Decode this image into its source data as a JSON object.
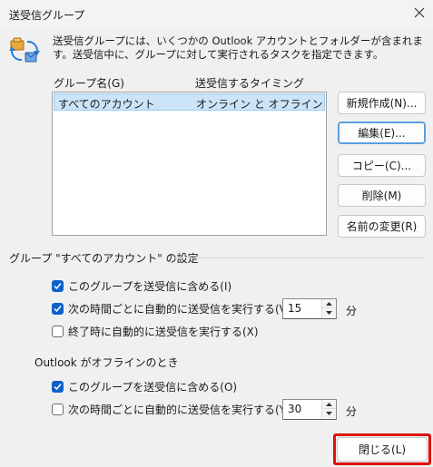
{
  "window": {
    "title": "送受信グループ",
    "close_icon": "close-icon"
  },
  "description": "送受信グループには、いくつかの Outlook アカウントとフォルダーが含まれます。送受信中に、グループに対して実行されるタスクを指定できます。",
  "list": {
    "col_name": "グループ名(G)",
    "col_timing": "送受信するタイミング",
    "rows": [
      {
        "name": "すべてのアカウント",
        "timing": "オンライン と オフライン"
      }
    ]
  },
  "buttons": {
    "new": "新規作成(N)...",
    "edit": "編集(E)...",
    "copy": "コピー(C)...",
    "delete": "削除(M)",
    "rename": "名前の変更(R)",
    "close": "閉じる(L)"
  },
  "settings": {
    "group_title": "グループ \"すべてのアカウント\" の設定",
    "online": {
      "include_label": "このグループを送受信に含める(I)",
      "include_checked": true,
      "auto_label": "次の時間ごとに自動的に送受信を実行する(V)",
      "auto_checked": true,
      "minutes": "15",
      "unit": "分",
      "on_exit_label": "終了時に自動的に送受信を実行する(X)",
      "on_exit_checked": false
    },
    "offline_title": "Outlook がオフラインのとき",
    "offline": {
      "include_label": "このグループを送受信に含める(O)",
      "include_checked": true,
      "auto_label": "次の時間ごとに自動的に送受信を実行する(Y)",
      "auto_checked": false,
      "minutes": "30",
      "unit": "分"
    }
  },
  "colors": {
    "accent": "#0a62c9",
    "selection": "#cce4f7",
    "highlight": "#e01010"
  }
}
